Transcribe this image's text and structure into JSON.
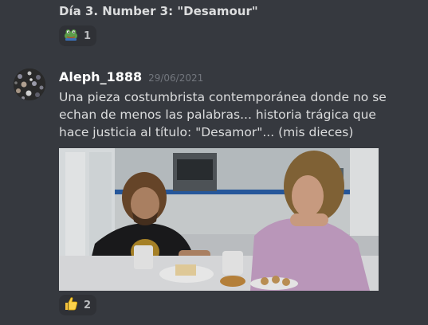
{
  "previous_message": {
    "title": "Día 3. Number 3: \"Desamour\"",
    "reaction": {
      "emoji": "frog-emoji",
      "count": "1"
    }
  },
  "message": {
    "username": "Aleph_1888",
    "timestamp": "29/06/2021",
    "text": "Una pieza costumbrista contemporánea donde no se echan de menos las palabras... historia trágica que hace justicia al título: \"Desamor\"... (mis dieces)",
    "reaction": {
      "emoji": "thumbs-up-emoji",
      "count": "2"
    }
  },
  "colors": {
    "background": "#36393f",
    "reaction_bg": "#2f3136",
    "username": "#ffffff",
    "timestamp": "#72767d",
    "text": "#dcddde"
  }
}
